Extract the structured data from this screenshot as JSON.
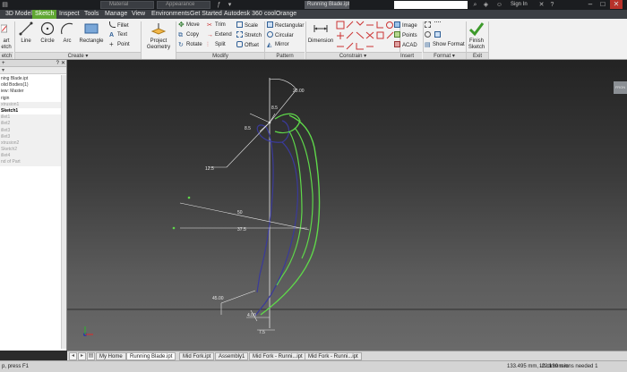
{
  "titlebar": {
    "material_placeholder": "Material",
    "appearance_placeholder": "Appearance",
    "document_title": "Running Blade.ipt",
    "sign_in": "Sign In"
  },
  "ribbon_tabs": [
    {
      "label": "3D Model",
      "active": false
    },
    {
      "label": "Sketch",
      "active": true
    },
    {
      "label": "Inspect",
      "active": false
    },
    {
      "label": "Tools",
      "active": false
    },
    {
      "label": "Manage",
      "active": false
    },
    {
      "label": "View",
      "active": false
    },
    {
      "label": "Environments",
      "active": false
    },
    {
      "label": "Get Started",
      "active": false
    },
    {
      "label": "Autodesk 360",
      "active": false
    },
    {
      "label": "coolOrange",
      "active": false
    }
  ],
  "ribbon": {
    "start_sketch": {
      "line1": "art",
      "line2": "etch"
    },
    "create": {
      "title": "Create",
      "line": "Line",
      "circle": "Circle",
      "arc": "Arc",
      "rectangle": "Rectangle",
      "fillet": "Fillet",
      "text": "Text",
      "point": "Point"
    },
    "project_geometry": {
      "line1": "Project",
      "line2": "Geometry"
    },
    "modify": {
      "title": "Modify",
      "move": "Move",
      "trim": "Trim",
      "scale": "Scale",
      "copy": "Copy",
      "extend": "Extend",
      "stretch": "Stretch",
      "rotate": "Rotate",
      "split": "Split",
      "offset": "Offset"
    },
    "pattern": {
      "title": "Pattern",
      "rectangular": "Rectangular",
      "circular": "Circular",
      "mirror": "Mirror"
    },
    "constrain": {
      "title": "Constrain",
      "dimension": "Dimension"
    },
    "insert": {
      "title": "Insert",
      "image": "Image",
      "points": "Points",
      "acad": "ACAD"
    },
    "format": {
      "title": "Format",
      "show_format": "Show Format"
    },
    "exit": {
      "title": "Exit",
      "finish_line1": "Finish",
      "finish_line2": "Sketch"
    },
    "left_panel_title": "etch"
  },
  "browser": {
    "tree": [
      {
        "label": "ning Blade.ipt",
        "style": "dark"
      },
      {
        "label": "olid Bodies(1)",
        "style": "dark"
      },
      {
        "label": "iew: Master",
        "style": "dark"
      },
      {
        "label": "rigin",
        "style": "dark"
      },
      {
        "label": "xtrusion1",
        "style": "grey"
      },
      {
        "label": "Sketch1",
        "style": "sel"
      },
      {
        "label": "illet1",
        "style": "grey"
      },
      {
        "label": "illet2",
        "style": "grey"
      },
      {
        "label": "illet3",
        "style": "grey"
      },
      {
        "label": "illet3",
        "style": "grey"
      },
      {
        "label": "xtrusion2",
        "style": "grey"
      },
      {
        "label": "Sketch2",
        "style": "grey"
      },
      {
        "label": "illet4",
        "style": "grey"
      },
      {
        "label": "nd of Part",
        "style": "grey"
      }
    ]
  },
  "canvas": {
    "dimensions": {
      "d_top": "20.00",
      "d_8a": "8.5",
      "d_8b": "8.5",
      "d_12": "12.5",
      "d_50": "50",
      "d_37": "37.5",
      "d_45": "45.00",
      "d_4": "4.00",
      "d_7": "7.5"
    },
    "viewcube_label": "FRON"
  },
  "doc_tabs": [
    {
      "label": "My Home",
      "active": false
    },
    {
      "label": "Running Blade.ipt",
      "active": true
    },
    {
      "label": "Mid Fork.ipt",
      "active": false
    },
    {
      "label": "Assembly1",
      "active": false
    },
    {
      "label": "Mid Fork - Runni...ipt",
      "active": false
    },
    {
      "label": "Mid Fork - Runni...ipt",
      "active": false
    }
  ],
  "status": {
    "message": "p, press F1",
    "coordinates": "133.495 mm, -22.139 mm",
    "dims_needed": "10 dimensions needed",
    "page": "1"
  },
  "colors": {
    "sketch_green": "#5fd84a",
    "sketch_blue": "#3a3a9a",
    "ribbon_active_tab": "#5fa632",
    "dimension_white": "#e8e8e8"
  }
}
